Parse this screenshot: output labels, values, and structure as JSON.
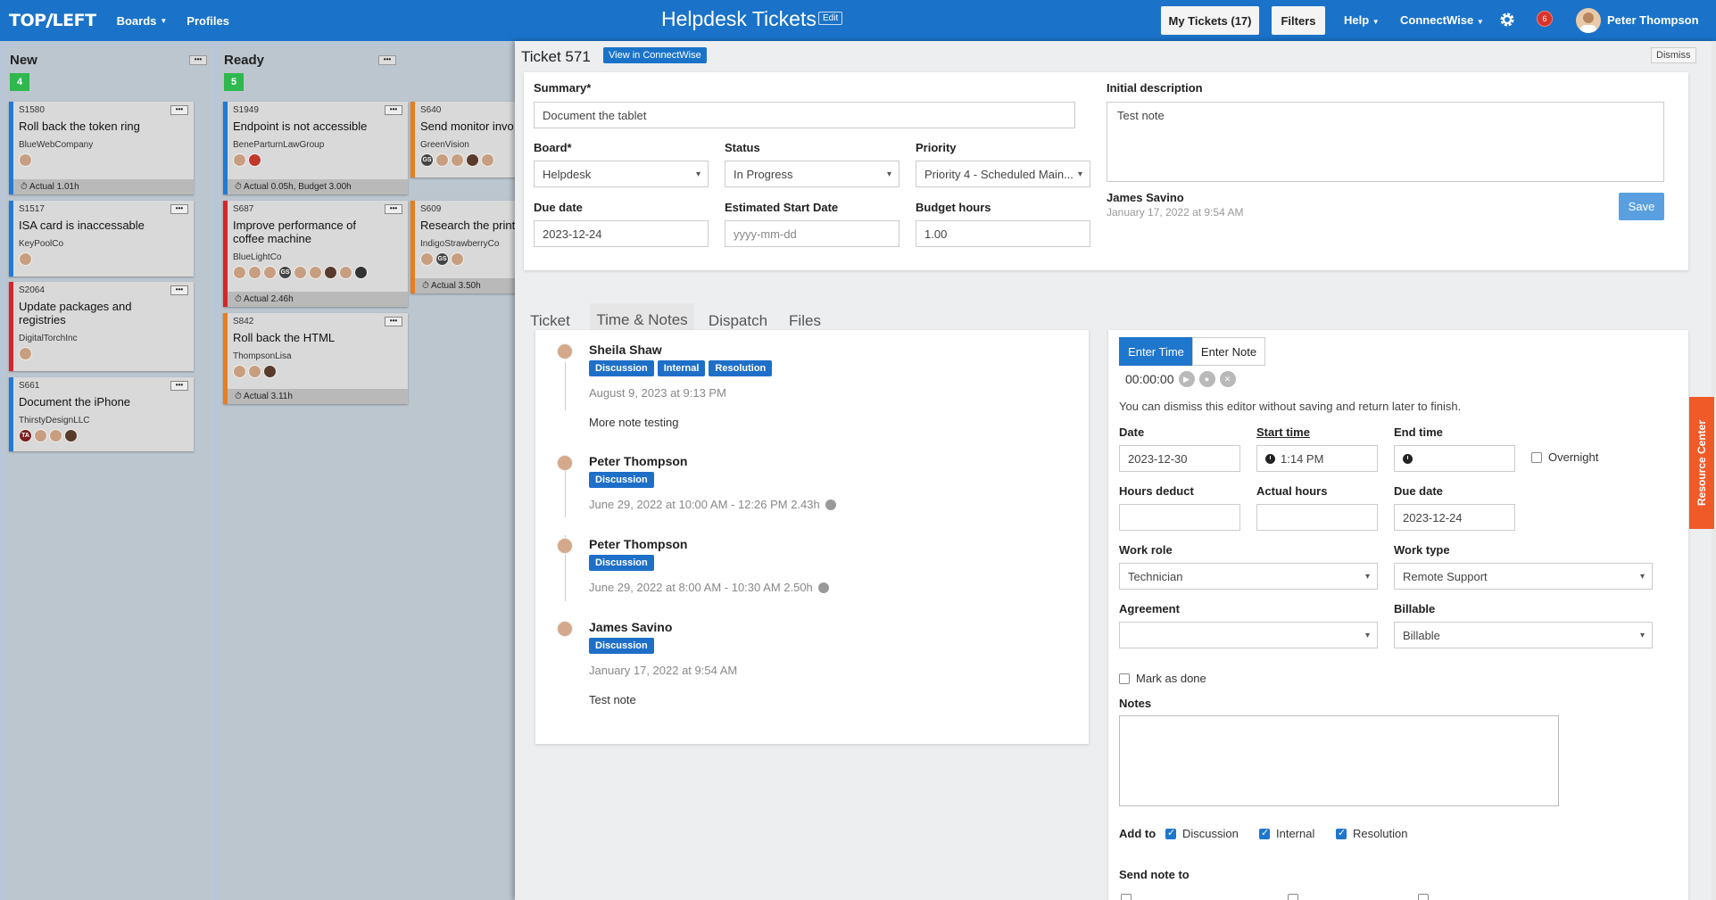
{
  "nav": {
    "logo_left": "TOP",
    "logo_right": "LEFT",
    "boards": "Boards",
    "profiles": "Profiles",
    "title": "Helpdesk Tickets",
    "edit": "Edit",
    "my_tickets": "My Tickets (17)",
    "filters": "Filters",
    "help": "Help",
    "connectwise": "ConnectWise",
    "notif_count": "6",
    "user": "Peter Thompson",
    "accent": "#1a73c9"
  },
  "board": {
    "columns": [
      {
        "name": "New",
        "count": "4",
        "cards": [
          {
            "id": "S1580",
            "title": "Roll back the token ring",
            "company": "BlueWebCompany",
            "footer": "Actual 1.01h"
          },
          {
            "id": "S1517",
            "title": "ISA card is inaccessable",
            "company": "KeyPoolCo",
            "footer": ""
          },
          {
            "id": "S2064",
            "title": "Update packages and registries",
            "company": "DigitalTorchInc",
            "footer": ""
          },
          {
            "id": "S661",
            "title": "Document the iPhone",
            "company": "ThirstyDesignLLC",
            "footer": ""
          }
        ]
      },
      {
        "name": "Ready",
        "count": "5",
        "cards": [
          {
            "id": "S1949",
            "title": "Endpoint is not accessible",
            "company": "BeneParturnLawGroup",
            "footer": "Actual 0.05h, Budget 3.00h"
          },
          {
            "id": "S687",
            "title": "Improve performance of coffee machine",
            "company": "BlueLightCo",
            "footer": "Actual 2.46h"
          },
          {
            "id": "S842",
            "title": "Roll back the HTML",
            "company": "ThompsonLisa",
            "footer": "Actual 3.11h"
          }
        ]
      },
      {
        "name": "",
        "count": "",
        "cards": [
          {
            "id": "S640",
            "title": "Send monitor invo",
            "company": "GreenVision",
            "footer": ""
          },
          {
            "id": "S609",
            "title": "Research the print",
            "company": "IndigoStrawberryCo",
            "footer": "Actual 3.50h"
          }
        ]
      }
    ]
  },
  "panel": {
    "ticket_title": "Ticket 571",
    "view_cw": "View in ConnectWise",
    "dismiss": "Dismiss",
    "summary_label": "Summary*",
    "summary_value": "Document the tablet",
    "board_label": "Board*",
    "board_value": "Helpdesk",
    "status_label": "Status",
    "status_value": "In Progress",
    "priority_label": "Priority",
    "priority_value": "Priority 4 - Scheduled Main...",
    "due_label": "Due date",
    "due_value": "2023-12-24",
    "est_label": "Estimated Start Date",
    "est_placeholder": "yyyy-mm-dd",
    "budget_label": "Budget hours",
    "budget_value": "1.00",
    "desc_label": "Initial description",
    "desc_value": "Test note",
    "desc_author": "James Savino",
    "desc_date": "January 17, 2022 at 9:54 AM",
    "save": "Save"
  },
  "tabs": [
    "Ticket",
    "Time & Notes",
    "Dispatch",
    "Files"
  ],
  "notes": [
    {
      "name": "Sheila Shaw",
      "badges": [
        "Discussion",
        "Internal",
        "Resolution"
      ],
      "date": "August 9, 2023 at 9:13 PM",
      "body": "More note testing",
      "clock": false
    },
    {
      "name": "Peter Thompson",
      "badges": [
        "Discussion"
      ],
      "date": "June 29, 2022 at 10:00 AM - 12:26 PM 2.43h",
      "body": "",
      "clock": true
    },
    {
      "name": "Peter Thompson",
      "badges": [
        "Discussion"
      ],
      "date": "June 29, 2022 at 8:00 AM - 10:30 AM 2.50h",
      "body": "",
      "clock": true
    },
    {
      "name": "James Savino",
      "badges": [
        "Discussion"
      ],
      "date": "January 17, 2022 at 9:54 AM",
      "body": "Test note",
      "clock": false
    }
  ],
  "time_entry": {
    "enter_time": "Enter Time",
    "enter_note": "Enter Note",
    "timer": "00:00:00",
    "hint": "You can dismiss this editor without saving and return later to finish.",
    "date_label": "Date",
    "date_value": "2023-12-30",
    "start_label": "Start time",
    "start_value": "1:14 PM",
    "end_label": "End time",
    "overnight": "Overnight",
    "hours_deduct_label": "Hours deduct",
    "actual_hours_label": "Actual hours",
    "due_label": "Due date",
    "due_value": "2023-12-24",
    "work_role_label": "Work role",
    "work_role_value": "Technician",
    "work_type_label": "Work type",
    "work_type_value": "Remote Support",
    "agreement_label": "Agreement",
    "billable_label": "Billable",
    "billable_value": "Billable",
    "mark_done": "Mark as done",
    "notes_label": "Notes",
    "add_to_label": "Add to",
    "add_discussion": "Discussion",
    "add_internal": "Internal",
    "add_resolution": "Resolution",
    "send_note_label": "Send note to"
  },
  "resource_center": "Resource Center"
}
